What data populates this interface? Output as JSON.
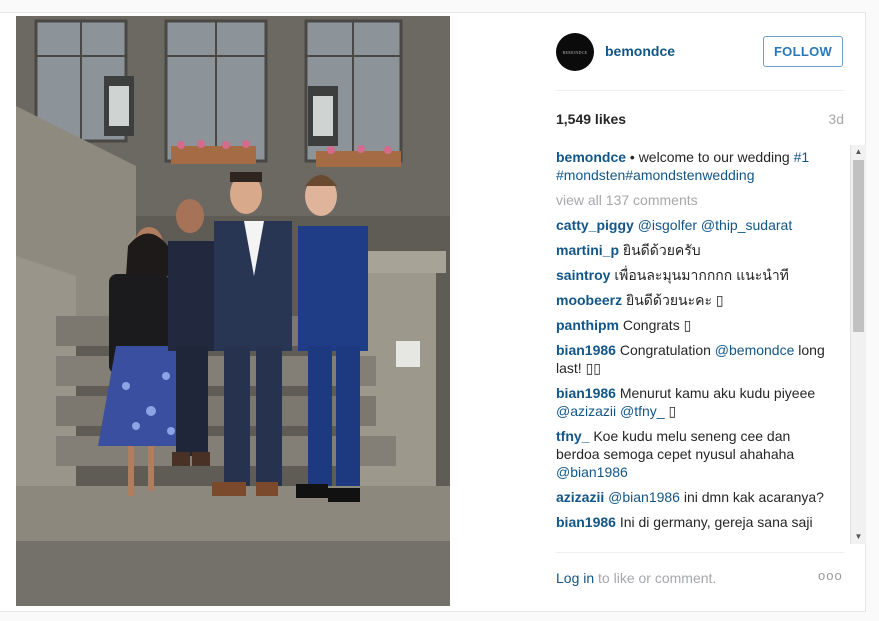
{
  "post": {
    "username": "bemondce",
    "avatar_text": "BEMONDCE",
    "follow_label": "FOLLOW",
    "likes": "1,549 likes",
    "age": "3d",
    "caption": {
      "user": "bemondce",
      "text": " • welcome to our wedding ",
      "tags": "#1 #mondsten#amondstenwedding"
    },
    "view_all": "view all 137 comments",
    "comments": [
      {
        "user": "catty_piggy",
        "text": " ",
        "mention": "@isgolfer @thip_sudarat"
      },
      {
        "user": "martini_p",
        "text": " ยินดีด้วยครับ",
        "mention": ""
      },
      {
        "user": "saintroy",
        "text": " เพื่อนละมุนมากกกก แนะนำที",
        "mention": ""
      },
      {
        "user": "moobeerz",
        "text": " ยินดีด้วยนะคะ ▯",
        "mention": ""
      },
      {
        "user": "panthipm",
        "text": " Congrats ▯",
        "mention": ""
      },
      {
        "user": "bian1986",
        "text": " Congratulation ",
        "mention": "@bemondce",
        "tail": " long last! ▯▯"
      },
      {
        "user": "bian1986",
        "text": " Menurut kamu aku kudu piyeee ",
        "mention": "@azizazii @tfny_",
        "tail": " ▯"
      },
      {
        "user": "tfny_",
        "text": " Koe kudu melu seneng cee dan berdoa semoga cepet nyusul ahahaha ",
        "mention": "@bian1986"
      },
      {
        "user": "azizazii",
        "text": " ",
        "mention": "@bian1986",
        "tail": " ini dmn kak acaranya?"
      },
      {
        "user": "bian1986",
        "text": " Ini di germany, gereja sana saji",
        "mention": ""
      }
    ],
    "login_link": "Log in",
    "login_text": " to like or comment.",
    "more_label": "ooo"
  },
  "colors": {
    "link": "#125688",
    "muted": "#a5a7aa",
    "follow_blue": "#2a77b8"
  }
}
